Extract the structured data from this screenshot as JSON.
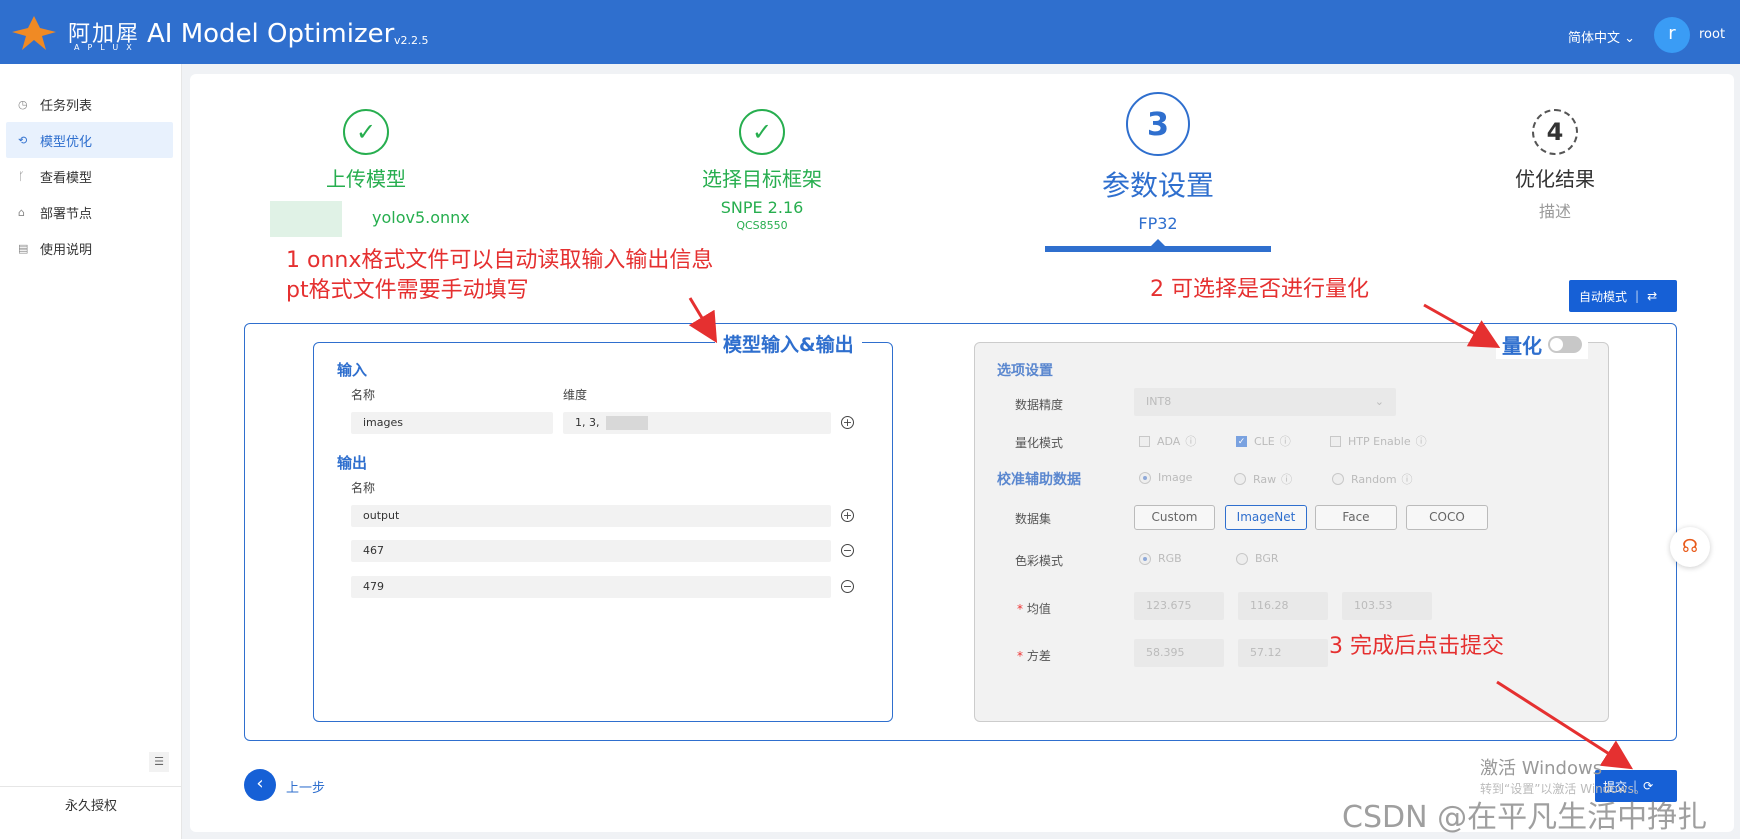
{
  "header": {
    "brand": "阿加犀",
    "brand_sub": "APLUX",
    "app_title": "AI Model Optimizer",
    "version": "v2.2.5",
    "language": "简体中文 ⌄",
    "avatar_initial": "r",
    "username": "root",
    "colors": {
      "header_bg": "#2f6fce",
      "accent": "#1660d6",
      "success": "#27ae4f",
      "annotation": "#e53030"
    }
  },
  "sidebar": {
    "items": [
      {
        "label": "任务列表",
        "icon": "history-icon"
      },
      {
        "label": "模型优化",
        "icon": "optimize-icon",
        "active": true
      },
      {
        "label": "查看模型",
        "icon": "branch-icon"
      },
      {
        "label": "部署节点",
        "icon": "deploy-icon"
      },
      {
        "label": "使用说明",
        "icon": "doc-icon"
      }
    ],
    "license": "永久授权"
  },
  "steps": [
    {
      "icon": "✓",
      "title": "上传模型",
      "sub": "yolov5.onnx"
    },
    {
      "icon": "✓",
      "title": "选择目标框架",
      "sub": "SNPE 2.16",
      "sub2": "QCS8550"
    },
    {
      "icon": "3",
      "title": "参数设置",
      "sub": "FP32"
    },
    {
      "icon": "4",
      "title": "优化结果",
      "sub": "描述"
    }
  ],
  "auto_mode": "自动模式",
  "io": {
    "legend": "模型输入&输出",
    "input_label": "输入",
    "name_col": "名称",
    "dim_col": "维度",
    "input_name": "images",
    "input_dim": "1, 3,",
    "output_label": "输出",
    "outputs": [
      "output",
      "467",
      "479"
    ]
  },
  "quant": {
    "legend": "量化",
    "enabled": false,
    "options_title": "选项设置",
    "precision_label": "数据精度",
    "precision_value": "INT8",
    "mode_label": "量化模式",
    "modes": [
      {
        "label": "ADA",
        "checked": false
      },
      {
        "label": "CLE",
        "checked": true
      },
      {
        "label": "HTP Enable",
        "checked": false
      }
    ],
    "calib_title": "校准辅助数据",
    "calib_types": [
      {
        "label": "Image",
        "on": true
      },
      {
        "label": "Raw",
        "on": false
      },
      {
        "label": "Random",
        "on": false
      }
    ],
    "dataset_label": "数据集",
    "datasets": [
      "Custom",
      "ImageNet",
      "Face",
      "COCO"
    ],
    "selected_dataset": "ImageNet",
    "color_label": "色彩模式",
    "color_modes": [
      {
        "label": "RGB",
        "on": true
      },
      {
        "label": "BGR",
        "on": false
      }
    ],
    "mean_label": "均值",
    "mean_values": [
      "123.675",
      "116.28",
      "103.53"
    ],
    "std_label": "方差",
    "std_values": [
      "58.395",
      "57.12"
    ]
  },
  "annotations": {
    "a1_line1": "1 onnx格式文件可以自动读取输入输出信息",
    "a1_line2": "pt格式文件需要手动填写",
    "a2": "2 可选择是否进行量化",
    "a3": "3 完成后点击提交"
  },
  "footer": {
    "prev": "上一步",
    "submit": "提交"
  },
  "watermark": {
    "line1": "激活 Windows",
    "line2": "转到“设置”以激活 Windows。",
    "csdn": "CSDN @在平凡生活中挣扎"
  }
}
